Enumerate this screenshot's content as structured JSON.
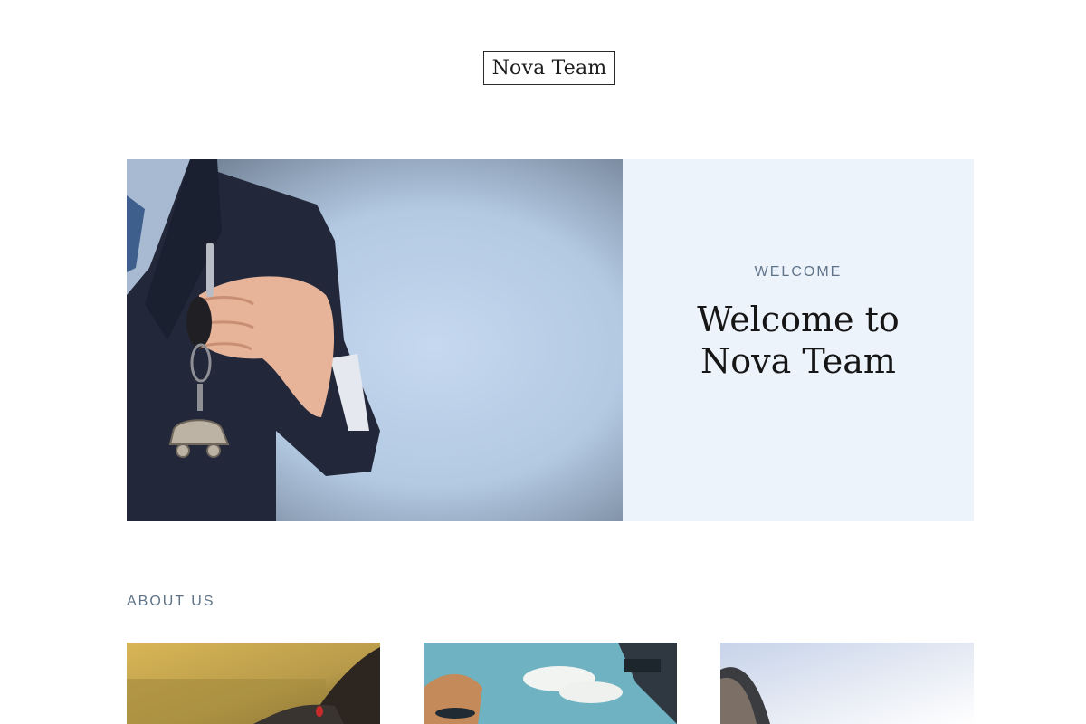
{
  "header": {
    "logo_text": "Nova Team"
  },
  "hero": {
    "image_subject": "businessman-holding-car-keys",
    "kicker": "WELCOME",
    "title": "Welcome to Nova Team"
  },
  "about": {
    "label": "ABOUT US",
    "cards": [
      {
        "image_subject": "woman-in-car-photo"
      },
      {
        "image_subject": "woman-in-convertible-photo"
      },
      {
        "image_subject": "car-window-sky-photo"
      }
    ]
  },
  "colors": {
    "panel_background": "#edf3fb",
    "kicker_color": "#5f7389",
    "title_color": "#161616"
  }
}
